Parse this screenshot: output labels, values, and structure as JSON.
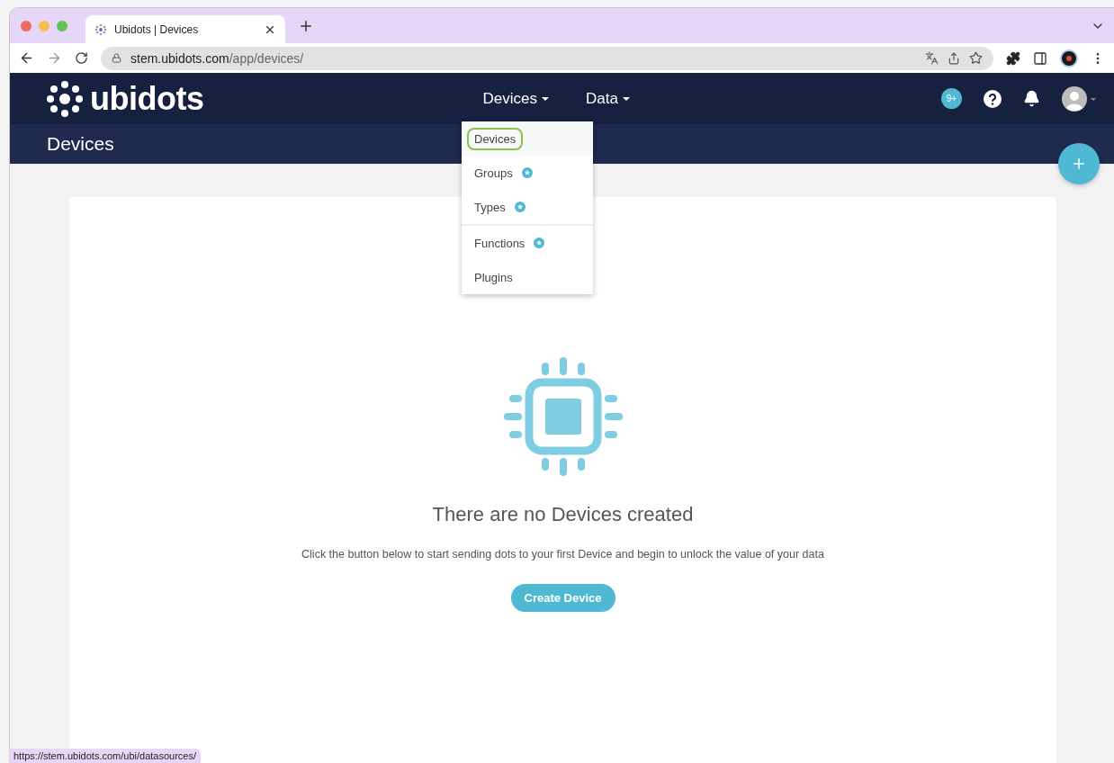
{
  "browser": {
    "tab": {
      "title": "Ubidots | Devices"
    },
    "url": {
      "host": "stem.ubidots.com",
      "path": "/app/devices/"
    },
    "status_url": "https://stem.ubidots.com/ubi/datasources/"
  },
  "navbar": {
    "logo": "ubidots",
    "menus": [
      {
        "label": "Devices"
      },
      {
        "label": "Data"
      }
    ],
    "badge": "9+"
  },
  "dropdown": [
    {
      "label": "Devices",
      "selected": true,
      "starred": false,
      "divider_before": false
    },
    {
      "label": "Groups",
      "selected": false,
      "starred": true,
      "divider_before": false
    },
    {
      "label": "Types",
      "selected": false,
      "starred": true,
      "divider_before": false
    },
    {
      "label": "Functions",
      "selected": false,
      "starred": true,
      "divider_before": true
    },
    {
      "label": "Plugins",
      "selected": false,
      "starred": false,
      "divider_before": false
    }
  ],
  "page_title": "Devices",
  "empty_state": {
    "title": "There are no Devices created",
    "text": "Click the button below to start sending dots to your first Device and begin to unlock the value of your data",
    "button": "Create Device"
  }
}
